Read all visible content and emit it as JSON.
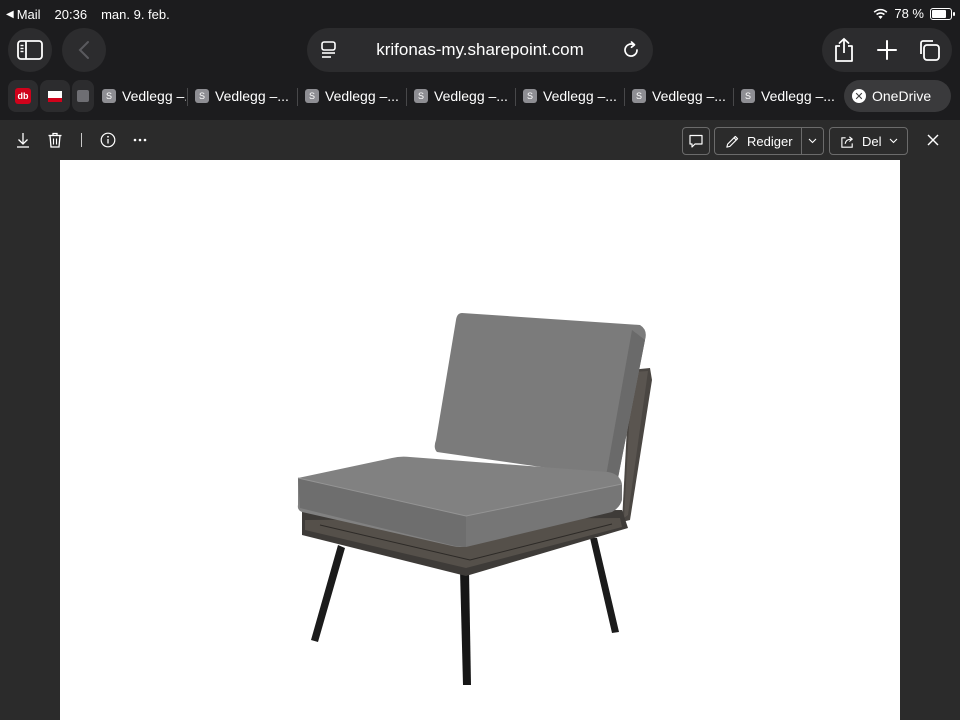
{
  "status_bar": {
    "back_app": "Mail",
    "time": "20:36",
    "date": "man. 9. feb.",
    "battery_text": "78 %",
    "battery_level": 0.78
  },
  "toolbar": {
    "url": "krifonas-my.sharepoint.com"
  },
  "tabs": {
    "items": [
      {
        "label": "Vedlegg –..."
      },
      {
        "label": "Vedlegg –..."
      },
      {
        "label": "Vedlegg –..."
      },
      {
        "label": "Vedlegg –..."
      },
      {
        "label": "Vedlegg –..."
      },
      {
        "label": "Vedlegg –..."
      },
      {
        "label": "Vedlegg –..."
      }
    ],
    "active_label": "OneDrive",
    "favicon_letter": "S"
  },
  "doc_toolbar": {
    "edit_label": "Rediger",
    "share_label": "Del"
  },
  "colors": {
    "background": "#1c1c1e",
    "control": "#2c2c2e",
    "viewer_bg": "#2b2b2b"
  }
}
